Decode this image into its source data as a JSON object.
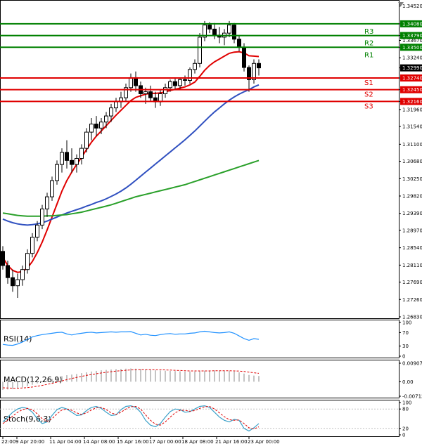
{
  "chart_data": {
    "type": "candlestick",
    "price_axis": {
      "ticks": [
        "1.34520",
        "1.34080",
        "1.33790",
        "1.33670",
        "1.33500",
        "1.33240",
        "1.32990",
        "1.32740",
        "1.32450",
        "1.32160",
        "1.31960",
        "1.31540",
        "1.31100",
        "1.30680",
        "1.30250",
        "1.29820",
        "1.29390",
        "1.28970",
        "1.28540",
        "1.28110",
        "1.27690",
        "1.27260",
        "1.26830"
      ],
      "tick_values": [
        1.3452,
        1.3408,
        1.3379,
        1.3367,
        1.335,
        1.3324,
        1.3299,
        1.3274,
        1.3245,
        1.3216,
        1.3196,
        1.3154,
        1.311,
        1.3068,
        1.3025,
        1.2982,
        1.2939,
        1.2897,
        1.2854,
        1.2811,
        1.2769,
        1.2726,
        1.2683
      ],
      "range": [
        1.2683,
        1.346
      ]
    },
    "time_labels": [
      "22:00",
      "9 Apr 20:00",
      "11 Apr 04:00",
      "14 Apr 08:00",
      "15 Apr 16:00",
      "17 Apr 00:00",
      "18 Apr 08:00",
      "21 Apr 16:00",
      "23 Apr 00:00"
    ],
    "current_price": {
      "label": "1.32990",
      "value": 1.3299
    },
    "levels": [
      {
        "name": "R3",
        "label": "1.34080",
        "value": 1.3408,
        "color": "#008000"
      },
      {
        "name": "R2",
        "label": "1.33790",
        "value": 1.3379,
        "color": "#008000"
      },
      {
        "name": "R1",
        "label": "1.33500",
        "value": 1.335,
        "color": "#008000"
      },
      {
        "name": "S1",
        "label": "1.32740",
        "value": 1.3274,
        "color": "#e00000"
      },
      {
        "name": "S2",
        "label": "1.32450",
        "value": 1.3245,
        "color": "#e00000"
      },
      {
        "name": "S3",
        "label": "1.32160",
        "value": 1.3216,
        "color": "#e00000"
      }
    ],
    "candles": [
      [
        1.2845,
        1.2858,
        1.28,
        1.281
      ],
      [
        1.281,
        1.2822,
        1.2765,
        1.278
      ],
      [
        1.278,
        1.28,
        1.2745,
        1.276
      ],
      [
        1.276,
        1.279,
        1.273,
        1.2775
      ],
      [
        1.2775,
        1.281,
        1.276,
        1.28
      ],
      [
        1.28,
        1.285,
        1.279,
        1.284
      ],
      [
        1.284,
        1.289,
        1.283,
        1.288
      ],
      [
        1.288,
        1.292,
        1.287,
        1.291
      ],
      [
        1.291,
        1.296,
        1.29,
        1.295
      ],
      [
        1.295,
        1.299,
        1.293,
        1.298
      ],
      [
        1.298,
        1.303,
        1.297,
        1.302
      ],
      [
        1.302,
        1.307,
        1.301,
        1.306
      ],
      [
        1.306,
        1.31,
        1.304,
        1.309
      ],
      [
        1.309,
        1.312,
        1.305,
        1.307
      ],
      [
        1.307,
        1.31,
        1.304,
        1.306
      ],
      [
        1.306,
        1.3085,
        1.304,
        1.3075
      ],
      [
        1.3075,
        1.311,
        1.306,
        1.31
      ],
      [
        1.31,
        1.315,
        1.309,
        1.314
      ],
      [
        1.314,
        1.3175,
        1.312,
        1.316
      ],
      [
        1.316,
        1.318,
        1.313,
        1.315
      ],
      [
        1.315,
        1.3175,
        1.3135,
        1.3165
      ],
      [
        1.3165,
        1.319,
        1.315,
        1.318
      ],
      [
        1.318,
        1.321,
        1.3165,
        1.32
      ],
      [
        1.32,
        1.3225,
        1.319,
        1.3215
      ],
      [
        1.3215,
        1.324,
        1.32,
        1.3225
      ],
      [
        1.3225,
        1.326,
        1.3215,
        1.325
      ],
      [
        1.325,
        1.3285,
        1.324,
        1.3275
      ],
      [
        1.3275,
        1.329,
        1.324,
        1.3255
      ],
      [
        1.3255,
        1.3265,
        1.3225,
        1.3235
      ],
      [
        1.3235,
        1.325,
        1.321,
        1.324
      ],
      [
        1.324,
        1.3255,
        1.3215,
        1.3225
      ],
      [
        1.3225,
        1.324,
        1.32,
        1.3215
      ],
      [
        1.3215,
        1.3245,
        1.3205,
        1.3235
      ],
      [
        1.3235,
        1.326,
        1.3225,
        1.325
      ],
      [
        1.325,
        1.327,
        1.324,
        1.3265
      ],
      [
        1.3265,
        1.3275,
        1.3245,
        1.3255
      ],
      [
        1.3255,
        1.3275,
        1.3245,
        1.327
      ],
      [
        1.327,
        1.328,
        1.3255,
        1.3268
      ],
      [
        1.3268,
        1.33,
        1.326,
        1.3295
      ],
      [
        1.3295,
        1.332,
        1.3285,
        1.331
      ],
      [
        1.331,
        1.3385,
        1.33,
        1.3375
      ],
      [
        1.3375,
        1.3415,
        1.3365,
        1.3405
      ],
      [
        1.3405,
        1.3412,
        1.3385,
        1.3395
      ],
      [
        1.3395,
        1.341,
        1.337,
        1.338
      ],
      [
        1.338,
        1.34,
        1.336,
        1.3375
      ],
      [
        1.3375,
        1.3395,
        1.3355,
        1.3385
      ],
      [
        1.3385,
        1.3415,
        1.3375,
        1.3405
      ],
      [
        1.3405,
        1.341,
        1.336,
        1.337
      ],
      [
        1.337,
        1.338,
        1.334,
        1.335
      ],
      [
        1.335,
        1.336,
        1.329,
        1.33
      ],
      [
        1.33,
        1.3305,
        1.324,
        1.327
      ],
      [
        1.327,
        1.332,
        1.326,
        1.331
      ],
      [
        1.331,
        1.332,
        1.328,
        1.3299
      ]
    ],
    "moving_averages": [
      {
        "color": "#e00000",
        "values": [
          1.283,
          1.281,
          1.2798,
          1.2793,
          1.2795,
          1.2804,
          1.282,
          1.2842,
          1.2868,
          1.2898,
          1.293,
          1.2962,
          1.2994,
          1.302,
          1.3041,
          1.306,
          1.3078,
          1.3097,
          1.3115,
          1.313,
          1.3143,
          1.3156,
          1.3169,
          1.3182,
          1.3194,
          1.3206,
          1.3218,
          1.3226,
          1.323,
          1.3234,
          1.3236,
          1.3236,
          1.3237,
          1.324,
          1.3243,
          1.3246,
          1.3249,
          1.3252,
          1.3257,
          1.3264,
          1.3278,
          1.3293,
          1.3305,
          1.3314,
          1.3321,
          1.3328,
          1.3335,
          1.3338,
          1.3339,
          1.3336,
          1.3329,
          1.3328,
          1.3327
        ]
      },
      {
        "color": "#3050c0",
        "values": [
          1.2925,
          1.292,
          1.2916,
          1.2913,
          1.2911,
          1.291,
          1.2911,
          1.2913,
          1.2916,
          1.292,
          1.2925,
          1.293,
          1.2935,
          1.294,
          1.2944,
          1.2948,
          1.2952,
          1.2957,
          1.2961,
          1.2966,
          1.297,
          1.2975,
          1.2981,
          1.2987,
          1.2994,
          1.3002,
          1.3011,
          1.3021,
          1.3031,
          1.3041,
          1.3051,
          1.3061,
          1.3071,
          1.3081,
          1.3091,
          1.3101,
          1.3111,
          1.3121,
          1.3132,
          1.3143,
          1.3155,
          1.3167,
          1.3179,
          1.319,
          1.32,
          1.321,
          1.3219,
          1.3227,
          1.3234,
          1.324,
          1.3245,
          1.3252,
          1.3257
        ]
      },
      {
        "color": "#2aa02a",
        "values": [
          1.294,
          1.2938,
          1.2936,
          1.2934,
          1.2933,
          1.2932,
          1.2932,
          1.2932,
          1.2932,
          1.2933,
          1.2933,
          1.2934,
          1.2935,
          1.2936,
          1.2938,
          1.294,
          1.2942,
          1.2945,
          1.2948,
          1.2951,
          1.2954,
          1.2957,
          1.296,
          1.2964,
          1.2968,
          1.2972,
          1.2976,
          1.298,
          1.2983,
          1.2986,
          1.2989,
          1.2992,
          1.2995,
          1.2998,
          1.3001,
          1.3004,
          1.3007,
          1.301,
          1.3014,
          1.3018,
          1.3022,
          1.3026,
          1.303,
          1.3034,
          1.3038,
          1.3042,
          1.3046,
          1.305,
          1.3054,
          1.3058,
          1.3062,
          1.3066,
          1.307
        ]
      }
    ],
    "indicators": [
      {
        "label": "RSI(14)",
        "ticks": [
          "100",
          "70",
          "30",
          "0"
        ],
        "tick_values": [
          100,
          70,
          30,
          0
        ],
        "range": [
          0,
          100
        ],
        "color": "#1e90ff",
        "values": [
          35,
          33,
          32,
          36,
          42,
          50,
          57,
          61,
          64,
          66,
          68,
          70,
          71,
          66,
          63,
          66,
          68,
          70,
          71,
          69,
          70,
          71,
          72,
          71,
          72,
          72,
          73,
          68,
          63,
          65,
          62,
          61,
          64,
          66,
          67,
          65,
          66,
          66,
          68,
          69,
          72,
          74,
          72,
          70,
          69,
          70,
          72,
          68,
          60,
          52,
          47,
          52,
          50
        ]
      },
      {
        "label": "MACD(12,26,9)",
        "ticks": [
          "0.009074",
          "0.00",
          "-0.007124"
        ],
        "tick_values": [
          0.009074,
          0,
          -0.007124
        ],
        "range": [
          -0.007124,
          0.009074
        ],
        "hist_color": "#b0b0b0",
        "signal_color": "#e00000",
        "histogram": [
          -0.004,
          -0.0038,
          -0.0036,
          -0.0033,
          -0.0028,
          -0.0022,
          -0.0015,
          -0.0008,
          -0.0001,
          0.0006,
          0.0013,
          0.002,
          0.0027,
          0.0032,
          0.0035,
          0.0038,
          0.0042,
          0.0046,
          0.005,
          0.0053,
          0.0056,
          0.0058,
          0.006,
          0.0062,
          0.0063,
          0.0064,
          0.0065,
          0.0064,
          0.0062,
          0.006,
          0.0058,
          0.0056,
          0.0055,
          0.0054,
          0.0053,
          0.0052,
          0.0051,
          0.005,
          0.005,
          0.005,
          0.0052,
          0.0054,
          0.0055,
          0.0055,
          0.0054,
          0.0053,
          0.0052,
          0.005,
          0.0046,
          0.004,
          0.0033,
          0.003,
          0.0028
        ],
        "signal": [
          -0.003,
          -0.0031,
          -0.0032,
          -0.0032,
          -0.0031,
          -0.0029,
          -0.0026,
          -0.0022,
          -0.0018,
          -0.0013,
          -0.0008,
          -0.0002,
          0.0004,
          0.001,
          0.0016,
          0.0021,
          0.0026,
          0.0031,
          0.0035,
          0.0039,
          0.0043,
          0.0046,
          0.0049,
          0.0052,
          0.0054,
          0.0056,
          0.0058,
          0.0059,
          0.006,
          0.006,
          0.006,
          0.0059,
          0.0059,
          0.0058,
          0.0057,
          0.0056,
          0.0055,
          0.0054,
          0.0053,
          0.0053,
          0.0053,
          0.0053,
          0.0053,
          0.0054,
          0.0054,
          0.0054,
          0.0054,
          0.0053,
          0.0052,
          0.005,
          0.0047,
          0.0044,
          0.0041
        ]
      },
      {
        "label": "Stoch(9,6,3)",
        "ticks": [
          "100",
          "80",
          "20",
          "0"
        ],
        "tick_values": [
          100,
          80,
          20,
          0
        ],
        "range": [
          0,
          100
        ],
        "main_color": "#3aa0c8",
        "signal_color": "#e00000",
        "main": [
          40,
          55,
          70,
          80,
          85,
          82,
          70,
          50,
          35,
          40,
          60,
          78,
          85,
          80,
          70,
          60,
          62,
          75,
          85,
          88,
          82,
          70,
          60,
          62,
          78,
          88,
          90,
          85,
          70,
          45,
          30,
          25,
          35,
          55,
          72,
          80,
          78,
          70,
          72,
          80,
          88,
          90,
          85,
          70,
          55,
          45,
          40,
          48,
          45,
          20,
          12,
          22,
          35
        ],
        "signal": [
          35,
          45,
          58,
          70,
          78,
          82,
          78,
          65,
          50,
          42,
          50,
          65,
          77,
          80,
          76,
          68,
          63,
          68,
          77,
          84,
          85,
          78,
          68,
          63,
          70,
          80,
          87,
          88,
          80,
          62,
          45,
          33,
          30,
          40,
          55,
          68,
          76,
          76,
          73,
          75,
          82,
          87,
          88,
          80,
          68,
          56,
          47,
          45,
          46,
          35,
          22,
          18,
          25
        ]
      }
    ]
  }
}
